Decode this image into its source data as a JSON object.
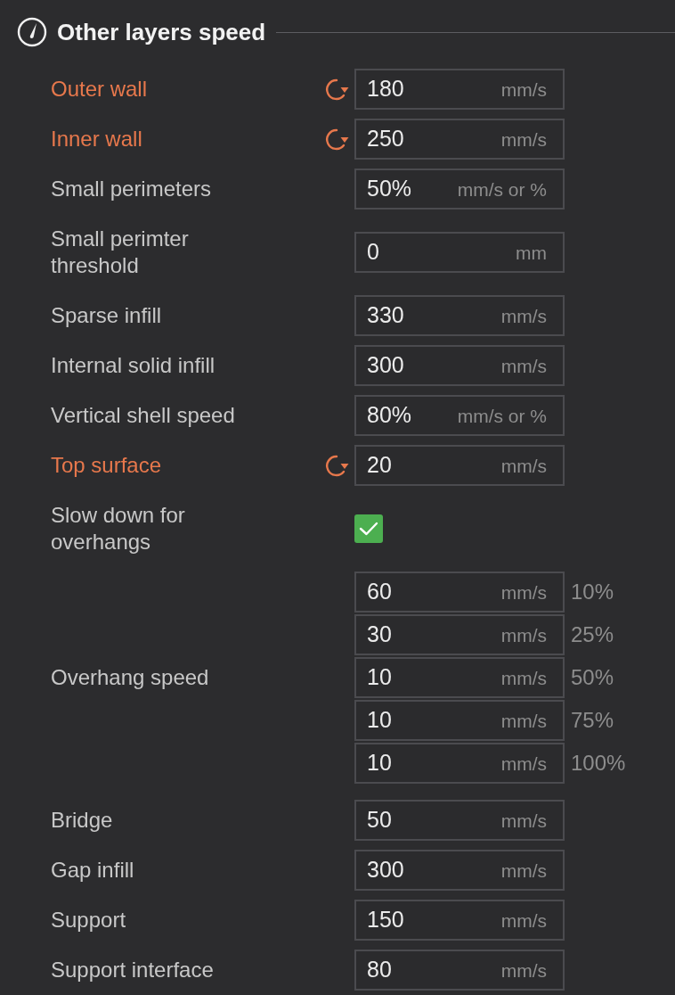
{
  "section": {
    "title": "Other layers speed"
  },
  "settings": [
    {
      "kind": "field",
      "label": "Outer wall",
      "modified": true,
      "value": "180",
      "unit": "mm/s"
    },
    {
      "kind": "field",
      "label": "Inner wall",
      "modified": true,
      "value": "250",
      "unit": "mm/s"
    },
    {
      "kind": "field",
      "label": "Small perimeters",
      "modified": false,
      "value": "50%",
      "unit": "mm/s or %"
    },
    {
      "kind": "field",
      "label": "Small perimter threshold",
      "modified": false,
      "value": "0",
      "unit": "mm"
    },
    {
      "kind": "field",
      "label": "Sparse infill",
      "modified": false,
      "value": "330",
      "unit": "mm/s"
    },
    {
      "kind": "field",
      "label": "Internal solid infill",
      "modified": false,
      "value": "300",
      "unit": "mm/s"
    },
    {
      "kind": "field",
      "label": "Vertical shell speed",
      "modified": false,
      "value": "80%",
      "unit": "mm/s or %"
    },
    {
      "kind": "field",
      "label": "Top surface",
      "modified": true,
      "value": "20",
      "unit": "mm/s"
    },
    {
      "kind": "checkbox",
      "label": "Slow down for overhangs",
      "modified": false,
      "checked": true
    },
    {
      "kind": "multi",
      "label": "Overhang speed",
      "modified": false,
      "fields": [
        {
          "value": "60",
          "unit": "mm/s",
          "threshold": "10%"
        },
        {
          "value": "30",
          "unit": "mm/s",
          "threshold": "25%"
        },
        {
          "value": "10",
          "unit": "mm/s",
          "threshold": "50%"
        },
        {
          "value": "10",
          "unit": "mm/s",
          "threshold": "75%"
        },
        {
          "value": "10",
          "unit": "mm/s",
          "threshold": "100%"
        }
      ]
    },
    {
      "kind": "field",
      "label": "Bridge",
      "modified": false,
      "value": "50",
      "unit": "mm/s"
    },
    {
      "kind": "field",
      "label": "Gap infill",
      "modified": false,
      "value": "300",
      "unit": "mm/s"
    },
    {
      "kind": "field",
      "label": "Support",
      "modified": false,
      "value": "150",
      "unit": "mm/s"
    },
    {
      "kind": "field",
      "label": "Support interface",
      "modified": false,
      "value": "80",
      "unit": "mm/s"
    }
  ]
}
